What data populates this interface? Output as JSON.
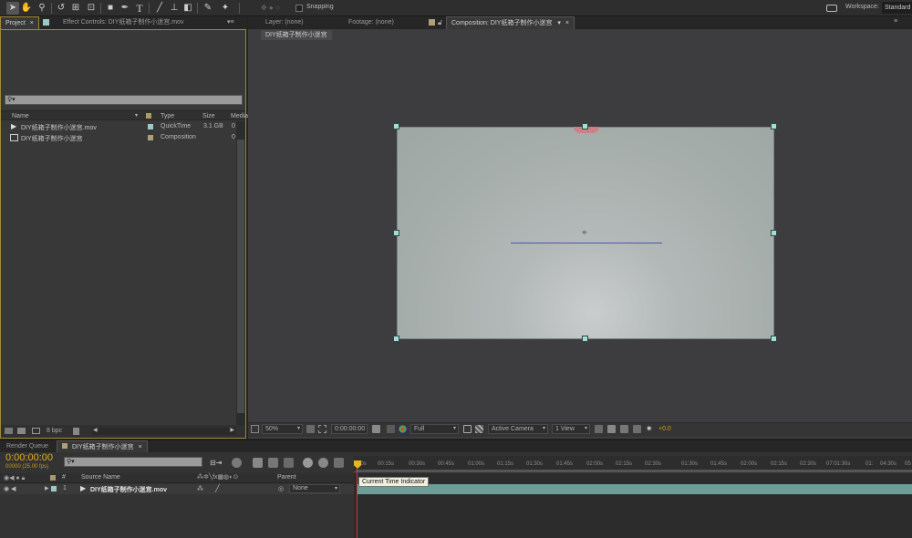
{
  "toolbar": {
    "snapping_label": "Snapping",
    "workspace_label": "Workspace:",
    "workspace_value": "Standard"
  },
  "project_panel": {
    "tab_label": "Project",
    "effect_controls_tab": "Effect Controls: DIY纸箱子制作小迷宫.mov",
    "search_placeholder": "",
    "columns": {
      "name": "Name",
      "type": "Type",
      "size": "Size",
      "media": "Media"
    },
    "items": [
      {
        "name": "DIY纸箱子制作小迷宫.mov",
        "type": "QuickTime",
        "size": "3.1 GB",
        "media": "0"
      },
      {
        "name": "DIY纸箱子制作小迷宫",
        "type": "Composition",
        "size": "",
        "media": "0"
      }
    ],
    "bpc_label": "8 bpc"
  },
  "viewer": {
    "layer_tab": "Layer: (none)",
    "footage_tab": "Footage: (none)",
    "composition_tab": "Composition: DIY纸箱子制作小迷宫",
    "comp_subtab": "DIY纸箱子制作小迷宫",
    "zoom": "50%",
    "timecode": "0:00:00:00",
    "resolution": "Full",
    "camera": "Active Camera",
    "view": "1 View",
    "exposure": "+0.0"
  },
  "timeline": {
    "render_queue_tab": "Render Queue",
    "comp_tab": "DIY纸箱子制作小迷宫",
    "current_time": "0:00:00:00",
    "frame_info": "00000 (25.00 fps)",
    "search_placeholder": "",
    "column_source_name": "Source Name",
    "column_number": "#",
    "column_parent": "Parent",
    "layer_number": "1",
    "layer_name": "DIY纸箱子制作小迷宫.mov",
    "parent_value": "None",
    "tooltip": "Current Time Indicator",
    "ticks": [
      "00s",
      "00:15s",
      "00:30s",
      "00:45s",
      "01:00s",
      "01:15s",
      "01:30s",
      "01:45s",
      "02:00s",
      "02:15s",
      "02:30s",
      "01:30s",
      "01:45s",
      "02:00s",
      "02:15s",
      "02:30s",
      "07:01:30s",
      "01:",
      "04:30s",
      "05"
    ]
  }
}
